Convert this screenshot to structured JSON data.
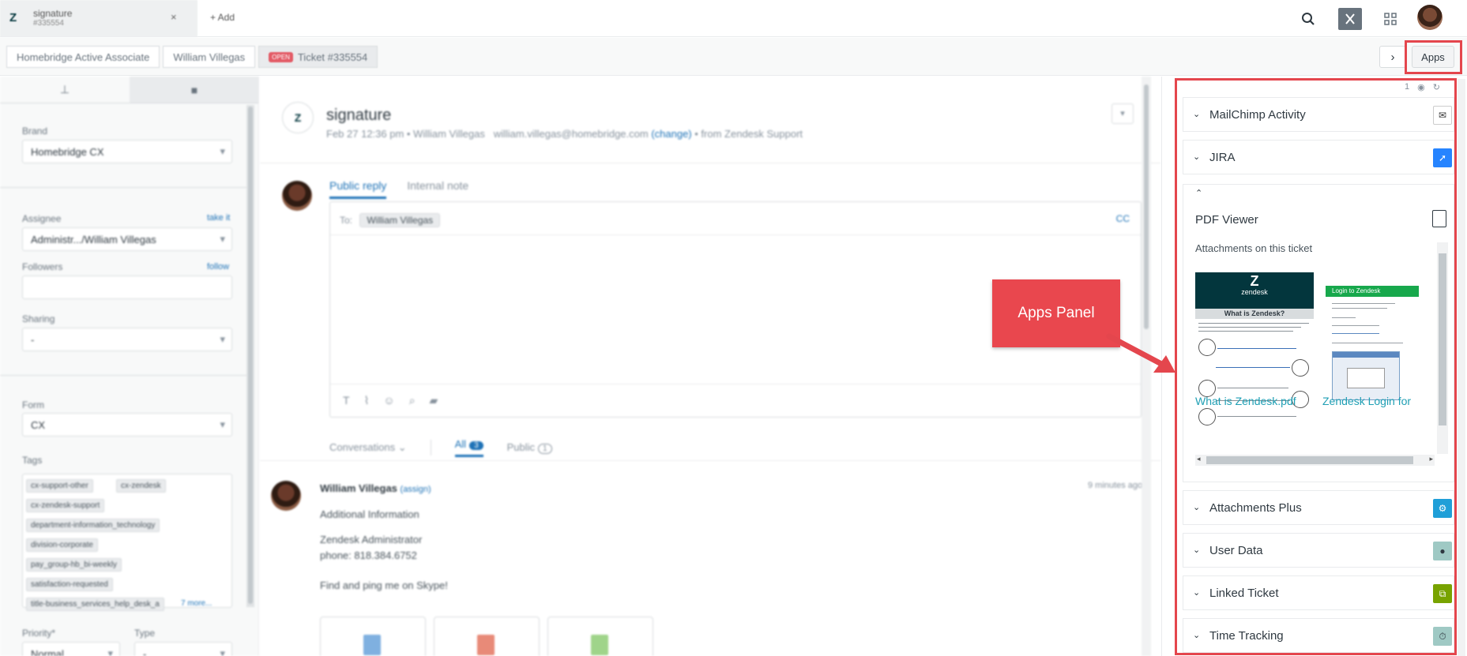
{
  "topbar": {
    "tab_title": "signature",
    "tab_subtitle": "#335554",
    "tab_close": "×",
    "add_label": "+ Add",
    "icons": [
      "search-icon",
      "close-square-icon",
      "apps-grid-icon",
      "user-avatar"
    ]
  },
  "breadcrumbs": {
    "items": [
      "Homebridge Active Associate",
      "William Villegas"
    ],
    "status_badge": "OPEN",
    "ticket_label": "Ticket #335554",
    "next_chevron": "›",
    "apps_button": "Apps"
  },
  "left_panel": {
    "brand_label": "Brand",
    "brand_value": "Homebridge CX",
    "assignee_label": "Assignee",
    "assignee_action": "take it",
    "assignee_value": "Administr.../William Villegas",
    "followers_label": "Followers",
    "followers_action": "follow",
    "sharing_label": "Sharing",
    "sharing_value": "-",
    "form_label": "Form",
    "form_value": "CX",
    "tags_label": "Tags",
    "tags": [
      "cx-support-other",
      "cx-zendesk",
      "cx-zendesk-support",
      "department-information_technology",
      "division-corporate",
      "pay_group-hb_bi-weekly",
      "satisfaction-requested",
      "title-business_services_help_desk_a"
    ],
    "more_tags": "7 more...",
    "priority_label": "Priority*",
    "priority_value": "Normal",
    "type_label": "Type",
    "type_value": "-"
  },
  "ticket": {
    "title": "signature",
    "meta": "Feb 27 12:36 pm • William Villegas",
    "email": "william.villegas@homebridge.com",
    "change_link": "(change)",
    "via": "• from Zendesk Support",
    "reply_tab_public": "Public reply",
    "reply_tab_internal": "Internal note",
    "to_label": "To:",
    "to_recipient": "William Villegas",
    "cc_label": "CC",
    "conv_filter": "Conversations ⌄",
    "conv_all": "All",
    "conv_all_count": "3",
    "conv_public": "Public",
    "conv_public_count": "1"
  },
  "message": {
    "author": "William Villegas",
    "assign_link": "(assign)",
    "time": "9 minutes ago",
    "line1": "Additional Information",
    "line2": "Zendesk Administrator",
    "line3": "phone: 818.384.6752",
    "line4": "Find and ping me on Skype!"
  },
  "apps_panel": {
    "top_count": "1",
    "apps": [
      {
        "name": "MailChimp Activity",
        "icon": "mailchimp-icon",
        "color": "#ffffff"
      },
      {
        "name": "JIRA",
        "icon": "jira-icon",
        "color": "#2684ff"
      },
      {
        "name": "Attachments Plus",
        "icon": "gear-icon",
        "color": "#1f9fd8"
      },
      {
        "name": "User Data",
        "icon": "user-data-icon",
        "color": "#9fc9c4"
      },
      {
        "name": "Linked Ticket",
        "icon": "linked-ticket-icon",
        "color": "#78a300"
      },
      {
        "name": "Time Tracking",
        "icon": "stopwatch-icon",
        "color": "#9fc9c4"
      }
    ],
    "pdf_viewer": {
      "title": "PDF Viewer",
      "subtitle": "Attachments on this ticket",
      "file1_link": "What is Zendesk.pdf",
      "file2_link": "Zendesk Login for",
      "thumb1_brand": "zendesk",
      "thumb1_heading": "What is Zendesk?",
      "thumb2_heading": "Login to Zendesk"
    }
  },
  "annotation": {
    "label": "Apps Panel",
    "color": "#e4464d"
  }
}
